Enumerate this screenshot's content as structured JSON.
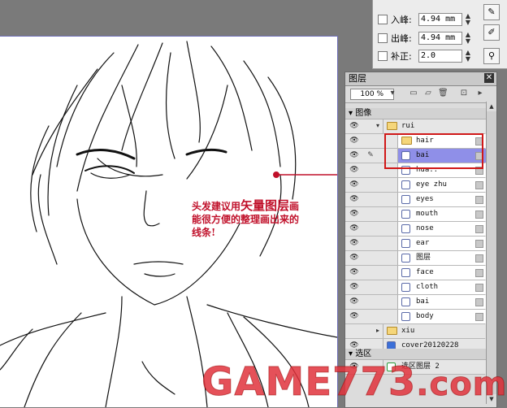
{
  "toolpanel": {
    "rows": [
      {
        "label": "入峰:",
        "value": "4.94 mm"
      },
      {
        "label": "出峰:",
        "value": "4.94 mm"
      },
      {
        "label": "补正:",
        "value": "2.0"
      }
    ],
    "tools": [
      "pen-tool-icon",
      "brush-tool-icon",
      "pen-pressure-icon"
    ]
  },
  "annotation": {
    "line1_pre": "头发建议用",
    "line1_big": "矢量图层",
    "line1_post": "画",
    "line2": "能很方便的整理画出来的",
    "line3": "线条!"
  },
  "layers_panel": {
    "title": "图层",
    "zoom": "100 %",
    "root_label": "图像",
    "layers": [
      {
        "name": "rui",
        "kind": "folder",
        "eye": true
      },
      {
        "name": "hair",
        "kind": "folder",
        "eye": true
      },
      {
        "name": "bai",
        "kind": "vector",
        "eye": true,
        "selected": true,
        "pen": true
      },
      {
        "name": "hua..",
        "kind": "vector",
        "eye": true
      },
      {
        "name": "eye zhu",
        "kind": "vector",
        "eye": true
      },
      {
        "name": "eyes",
        "kind": "vector",
        "eye": true
      },
      {
        "name": "mouth",
        "kind": "vector",
        "eye": true
      },
      {
        "name": "nose",
        "kind": "vector",
        "eye": true
      },
      {
        "name": "ear",
        "kind": "vector",
        "eye": true
      },
      {
        "name": "图层",
        "kind": "vector",
        "eye": true
      },
      {
        "name": "face",
        "kind": "vector",
        "eye": true
      },
      {
        "name": "cloth",
        "kind": "vector",
        "eye": true
      },
      {
        "name": "bai",
        "kind": "vector",
        "eye": true
      },
      {
        "name": "body",
        "kind": "vector",
        "eye": true
      },
      {
        "name": "xiu",
        "kind": "folder",
        "eye": false
      },
      {
        "name": "cover20120228",
        "kind": "paper",
        "eye": true
      }
    ],
    "selection_section": "选区",
    "selection_layer": "选区图层 2"
  },
  "watermark": {
    "text": "GAME773",
    "domain": ".com"
  },
  "colors": {
    "selected_row": "#8f8fe8",
    "highlight_box": "#d01818",
    "annotation": "#c0102a"
  }
}
